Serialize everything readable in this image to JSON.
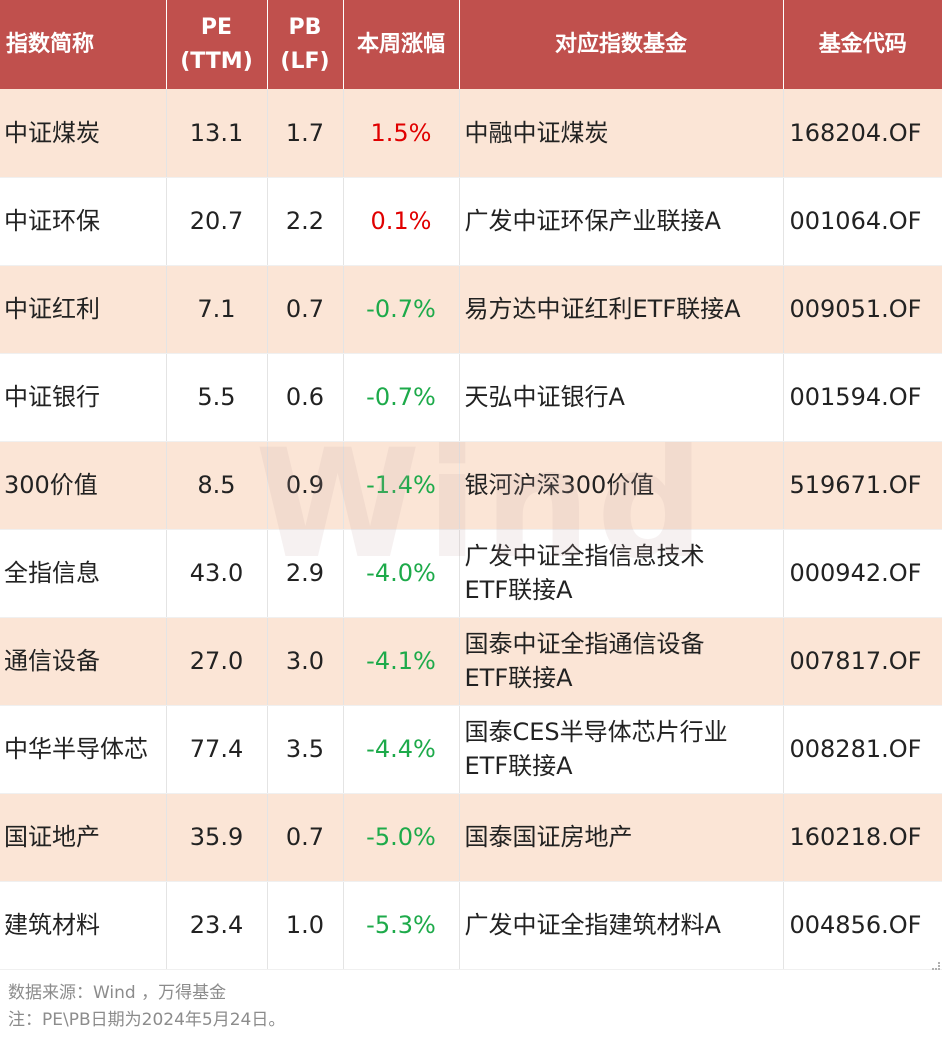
{
  "watermark": "Wind",
  "headers": {
    "index_name": "指数简称",
    "pe_line1": "PE",
    "pe_line2": "(TTM)",
    "pb_line1": "PB",
    "pb_line2": "(LF)",
    "weekly_change": "本周涨幅",
    "fund_name": "对应指数基金",
    "fund_code": "基金代码"
  },
  "rows": [
    {
      "index": "中证煤炭",
      "pe": "13.1",
      "pb": "1.7",
      "change": "1.5%",
      "direction": "up",
      "fund_line1": "中融中证煤炭",
      "fund_line2": "",
      "code": "168204.OF"
    },
    {
      "index": "中证环保",
      "pe": "20.7",
      "pb": "2.2",
      "change": "0.1%",
      "direction": "up",
      "fund_line1": "广发中证环保产业联接A",
      "fund_line2": "",
      "code": "001064.OF"
    },
    {
      "index": "中证红利",
      "pe": "7.1",
      "pb": "0.7",
      "change": "-0.7%",
      "direction": "down",
      "fund_line1": "易方达中证红利ETF联接A",
      "fund_line2": "",
      "code": "009051.OF"
    },
    {
      "index": "中证银行",
      "pe": "5.5",
      "pb": "0.6",
      "change": "-0.7%",
      "direction": "down",
      "fund_line1": "天弘中证银行A",
      "fund_line2": "",
      "code": "001594.OF"
    },
    {
      "index": "300价值",
      "pe": "8.5",
      "pb": "0.9",
      "change": "-1.4%",
      "direction": "down",
      "fund_line1": "银河沪深300价值",
      "fund_line2": "",
      "code": "519671.OF"
    },
    {
      "index": "全指信息",
      "pe": "43.0",
      "pb": "2.9",
      "change": "-4.0%",
      "direction": "down",
      "fund_line1": "广发中证全指信息技术",
      "fund_line2": "ETF联接A",
      "code": "000942.OF"
    },
    {
      "index": "通信设备",
      "pe": "27.0",
      "pb": "3.0",
      "change": "-4.1%",
      "direction": "down",
      "fund_line1": "国泰中证全指通信设备",
      "fund_line2": "ETF联接A",
      "code": "007817.OF"
    },
    {
      "index": "中华半导体芯",
      "pe": "77.4",
      "pb": "3.5",
      "change": "-4.4%",
      "direction": "down",
      "fund_line1": "国泰CES半导体芯片行业",
      "fund_line2": "ETF联接A",
      "code": "008281.OF"
    },
    {
      "index": "国证地产",
      "pe": "35.9",
      "pb": "0.7",
      "change": "-5.0%",
      "direction": "down",
      "fund_line1": "国泰国证房地产",
      "fund_line2": "",
      "code": "160218.OF"
    },
    {
      "index": "建筑材料",
      "pe": "23.4",
      "pb": "1.0",
      "change": "-5.3%",
      "direction": "down",
      "fund_line1": "广发中证全指建筑材料A",
      "fund_line2": "",
      "code": "004856.OF"
    }
  ],
  "footer": {
    "source": "数据来源：Wind ，万得基金",
    "note": "注：PE\\PB日期为2024年5月24日。"
  },
  "colors": {
    "header_bg": "#c0504d",
    "stripe_bg": "#fbe5d6",
    "up": "#e00000",
    "down": "#1daa4a"
  }
}
